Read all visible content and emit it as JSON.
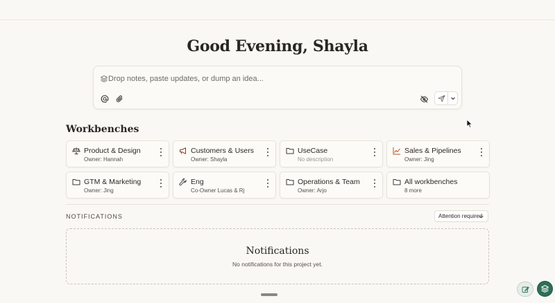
{
  "greeting": "Good Evening, Shayla",
  "composer": {
    "placeholder": "Drop notes, paste updates, or dump an idea..."
  },
  "workbenches": {
    "title": "Workbenches",
    "cards": [
      {
        "name": "Product & Design",
        "sub": "Owner: Hannah",
        "icon": "scale-icon"
      },
      {
        "name": "Customers & Users",
        "sub": "Owner: Shayla",
        "icon": "megaphone-icon"
      },
      {
        "name": "UseCase",
        "sub": "No description",
        "icon": "folder-icon"
      },
      {
        "name": "Sales & Pipelines",
        "sub": "Owner: Jing",
        "icon": "chart-line-icon"
      },
      {
        "name": "GTM & Marketing",
        "sub": "Owner: Jing",
        "icon": "folder-icon"
      },
      {
        "name": "Eng",
        "sub": "Co-Owner Lucas & Rj",
        "icon": "wrench-icon"
      },
      {
        "name": "Operations & Team",
        "sub": "Owner: Arjo",
        "icon": "folder-icon"
      },
      {
        "name": "All workbenches",
        "sub": "8 more",
        "icon": "folder-icon"
      }
    ]
  },
  "notifications": {
    "label": "NOTIFICATIONS",
    "filter": "Attention required",
    "empty_title": "Notifications",
    "empty_text": "No notifications for this project yet."
  },
  "colors": {
    "background": "#faf8f4",
    "accent": "#2f6e57",
    "sales_icon": "#b0552a"
  }
}
